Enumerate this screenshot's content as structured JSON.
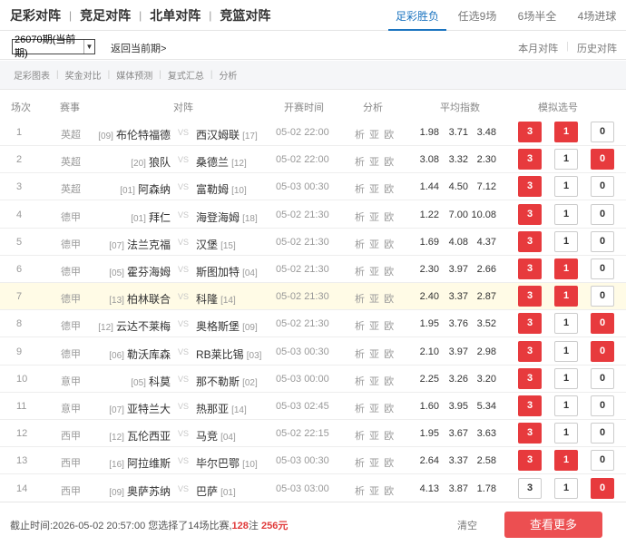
{
  "nav": {
    "main_tabs": [
      "足彩对阵",
      "竞足对阵",
      "北单对阵",
      "竞篮对阵"
    ],
    "separator": "|",
    "sub_tabs": [
      "足彩胜负",
      "任选9场",
      "6场半全",
      "4场进球"
    ],
    "active_sub_tab": 0
  },
  "period": {
    "selected": "26070期(当前期)",
    "return_label": "返回当前期>",
    "links": [
      "本月对阵",
      "历史对阵"
    ]
  },
  "toolbar": [
    "足彩图表",
    "奖金对比",
    "媒体预测",
    "复式汇总",
    "分析"
  ],
  "table": {
    "headers": {
      "num": "场次",
      "league": "赛事",
      "match": "对阵",
      "time": "开赛时间",
      "analysis": "分析",
      "odds": "平均指数",
      "picks": "模拟选号"
    },
    "vs_label": "VS",
    "analysis_label": "析 亚 欧",
    "pick_labels": [
      "3",
      "1",
      "0"
    ],
    "rows": [
      {
        "num": "1",
        "league": "英超",
        "home_rank": "[09]",
        "home": "布伦特福德",
        "away": "西汉姆联",
        "away_rank": "[17]",
        "time": "05-02 22:00",
        "o1": "1.98",
        "o2": "3.71",
        "o3": "3.48",
        "picks": [
          true,
          true,
          false
        ],
        "highlight": false
      },
      {
        "num": "2",
        "league": "英超",
        "home_rank": "[20]",
        "home": "狼队",
        "away": "桑德兰",
        "away_rank": "[12]",
        "time": "05-02 22:00",
        "o1": "3.08",
        "o2": "3.32",
        "o3": "2.30",
        "picks": [
          true,
          false,
          true
        ],
        "highlight": false
      },
      {
        "num": "3",
        "league": "英超",
        "home_rank": "[01]",
        "home": "阿森纳",
        "away": "富勒姆",
        "away_rank": "[10]",
        "time": "05-03 00:30",
        "o1": "1.44",
        "o2": "4.50",
        "o3": "7.12",
        "picks": [
          true,
          false,
          false
        ],
        "highlight": false
      },
      {
        "num": "4",
        "league": "德甲",
        "home_rank": "[01]",
        "home": "拜仁",
        "away": "海登海姆",
        "away_rank": "[18]",
        "time": "05-02 21:30",
        "o1": "1.22",
        "o2": "7.00",
        "o3": "10.08",
        "picks": [
          true,
          false,
          false
        ],
        "highlight": false
      },
      {
        "num": "5",
        "league": "德甲",
        "home_rank": "[07]",
        "home": "法兰克福",
        "away": "汉堡",
        "away_rank": "[15]",
        "time": "05-02 21:30",
        "o1": "1.69",
        "o2": "4.08",
        "o3": "4.37",
        "picks": [
          true,
          false,
          false
        ],
        "highlight": false
      },
      {
        "num": "6",
        "league": "德甲",
        "home_rank": "[05]",
        "home": "霍芬海姆",
        "away": "斯图加特",
        "away_rank": "[04]",
        "time": "05-02 21:30",
        "o1": "2.30",
        "o2": "3.97",
        "o3": "2.66",
        "picks": [
          true,
          true,
          false
        ],
        "highlight": false
      },
      {
        "num": "7",
        "league": "德甲",
        "home_rank": "[13]",
        "home": "柏林联合",
        "away": "科隆",
        "away_rank": "[14]",
        "time": "05-02 21:30",
        "o1": "2.40",
        "o2": "3.37",
        "o3": "2.87",
        "picks": [
          true,
          true,
          false
        ],
        "highlight": true
      },
      {
        "num": "8",
        "league": "德甲",
        "home_rank": "[12]",
        "home": "云达不莱梅",
        "away": "奥格斯堡",
        "away_rank": "[09]",
        "time": "05-02 21:30",
        "o1": "1.95",
        "o2": "3.76",
        "o3": "3.52",
        "picks": [
          true,
          false,
          true
        ],
        "highlight": false
      },
      {
        "num": "9",
        "league": "德甲",
        "home_rank": "[06]",
        "home": "勒沃库森",
        "away": "RB莱比锡",
        "away_rank": "[03]",
        "time": "05-03 00:30",
        "o1": "2.10",
        "o2": "3.97",
        "o3": "2.98",
        "picks": [
          true,
          false,
          true
        ],
        "highlight": false
      },
      {
        "num": "10",
        "league": "意甲",
        "home_rank": "[05]",
        "home": "科莫",
        "away": "那不勒斯",
        "away_rank": "[02]",
        "time": "05-03 00:00",
        "o1": "2.25",
        "o2": "3.26",
        "o3": "3.20",
        "picks": [
          true,
          false,
          false
        ],
        "highlight": false
      },
      {
        "num": "11",
        "league": "意甲",
        "home_rank": "[07]",
        "home": "亚特兰大",
        "away": "热那亚",
        "away_rank": "[14]",
        "time": "05-03 02:45",
        "o1": "1.60",
        "o2": "3.95",
        "o3": "5.34",
        "picks": [
          true,
          false,
          false
        ],
        "highlight": false
      },
      {
        "num": "12",
        "league": "西甲",
        "home_rank": "[12]",
        "home": "瓦伦西亚",
        "away": "马竞",
        "away_rank": "[04]",
        "time": "05-02 22:15",
        "o1": "1.95",
        "o2": "3.67",
        "o3": "3.63",
        "picks": [
          true,
          false,
          false
        ],
        "highlight": false
      },
      {
        "num": "13",
        "league": "西甲",
        "home_rank": "[16]",
        "home": "阿拉维斯",
        "away": "毕尔巴鄂",
        "away_rank": "[10]",
        "time": "05-03 00:30",
        "o1": "2.64",
        "o2": "3.37",
        "o3": "2.58",
        "picks": [
          true,
          true,
          false
        ],
        "highlight": false
      },
      {
        "num": "14",
        "league": "西甲",
        "home_rank": "[09]",
        "home": "奥萨苏纳",
        "away": "巴萨",
        "away_rank": "[01]",
        "time": "05-03 03:00",
        "o1": "4.13",
        "o2": "3.87",
        "o3": "1.78",
        "picks": [
          false,
          false,
          true
        ],
        "highlight": false
      }
    ]
  },
  "footer": {
    "deadline_text": "截止时间:2026-05-02 20:57:00 您选择了14场比赛,",
    "bets": "128",
    "bets_unit": "注",
    "amount": "256元",
    "clear_label": "清空",
    "more_label": "查看更多"
  },
  "colors": {
    "accent_red": "#e73a3d",
    "active_tab_blue": "#1b74c0",
    "highlight_row": "#fffbe6"
  }
}
